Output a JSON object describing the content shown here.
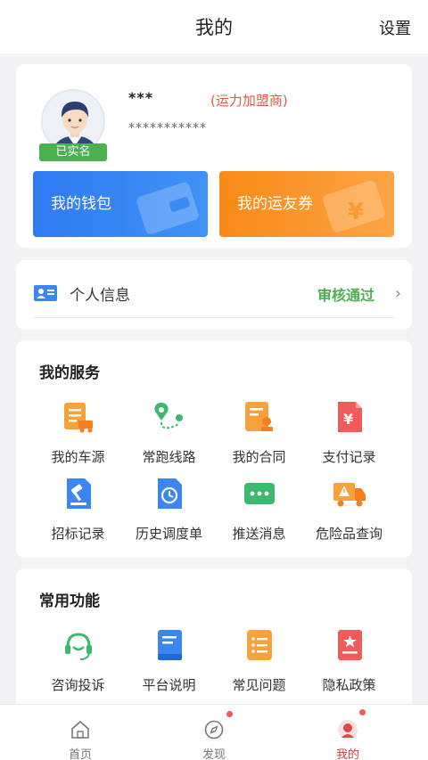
{
  "header": {
    "title": "我的",
    "settings": "设置"
  },
  "profile": {
    "name": "***",
    "role": "(运力加盟商)",
    "phone": "***********",
    "verified_badge": "已实名",
    "wallet_label": "我的钱包",
    "coupon_label": "我的运友券"
  },
  "personal_info": {
    "label": "个人信息",
    "status": "审核通过",
    "status_color": "#4caf50"
  },
  "services": {
    "title": "我的服务",
    "items": [
      {
        "label": "我的车源",
        "icon": "truck-list-icon"
      },
      {
        "label": "常跑线路",
        "icon": "route-icon"
      },
      {
        "label": "我的合同",
        "icon": "contract-icon"
      },
      {
        "label": "支付记录",
        "icon": "payment-record-icon"
      },
      {
        "label": "招标记录",
        "icon": "bid-gavel-icon"
      },
      {
        "label": "历史调度单",
        "icon": "history-dispatch-icon"
      },
      {
        "label": "推送消息",
        "icon": "message-icon"
      },
      {
        "label": "危险品查询",
        "icon": "hazard-truck-icon"
      }
    ]
  },
  "functions": {
    "title": "常用功能",
    "items": [
      {
        "label": "咨询投诉",
        "icon": "headset-icon"
      },
      {
        "label": "平台说明",
        "icon": "book-icon"
      },
      {
        "label": "常见问题",
        "icon": "faq-list-icon"
      },
      {
        "label": "隐私政策",
        "icon": "privacy-icon"
      }
    ]
  },
  "tabbar": {
    "items": [
      {
        "label": "首页",
        "icon": "home-icon"
      },
      {
        "label": "发现",
        "icon": "compass-icon"
      },
      {
        "label": "我的",
        "icon": "profile-icon"
      }
    ],
    "active_color": "#e03b3b"
  },
  "colors": {
    "accent_red": "#e05a47",
    "wallet_blue": "#2f7af0",
    "coupon_orange": "#f88a17"
  }
}
